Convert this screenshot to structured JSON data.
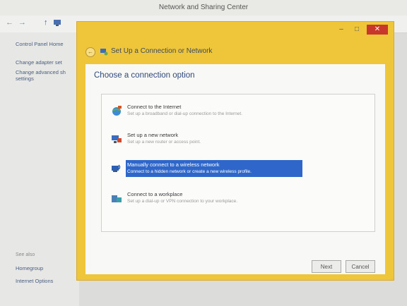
{
  "background_window": {
    "title": "Network and Sharing Center",
    "nav": {
      "back": "←",
      "forward": "→",
      "up": "↑",
      "network_icon": "network-icon"
    },
    "sidebar": {
      "items": [
        {
          "label": "Control Panel Home"
        },
        {
          "label": "Change adapter set"
        },
        {
          "label": "Change advanced sh settings"
        }
      ],
      "see_also_heading": "See also",
      "see_also": [
        {
          "label": "Homegroup"
        },
        {
          "label": "Internet Options"
        }
      ]
    }
  },
  "dialog": {
    "title": "Set Up a Connection or Network",
    "caption_buttons": {
      "minimize": "–",
      "maximize": "□",
      "close": "✕"
    },
    "heading": "Choose a connection option",
    "options": [
      {
        "title": "Connect to the Internet",
        "description": "Set up a broadband or dial-up connection to the Internet.",
        "icon": "globe-icon",
        "selected": false
      },
      {
        "title": "Set up a new network",
        "description": "Set up a new router or access point.",
        "icon": "router-icon",
        "selected": false
      },
      {
        "title": "Manually connect to a wireless network",
        "description": "Connect to a hidden network or create a new wireless profile.",
        "icon": "wireless-icon",
        "selected": true
      },
      {
        "title": "Connect to a workplace",
        "description": "Set up a dial-up or VPN connection to your workplace.",
        "icon": "workplace-icon",
        "selected": false
      }
    ],
    "buttons": {
      "next": "Next",
      "cancel": "Cancel"
    }
  },
  "colors": {
    "dialog_frame": "#efc63a",
    "selection": "#2e67c9",
    "heading": "#2f4a7a"
  }
}
